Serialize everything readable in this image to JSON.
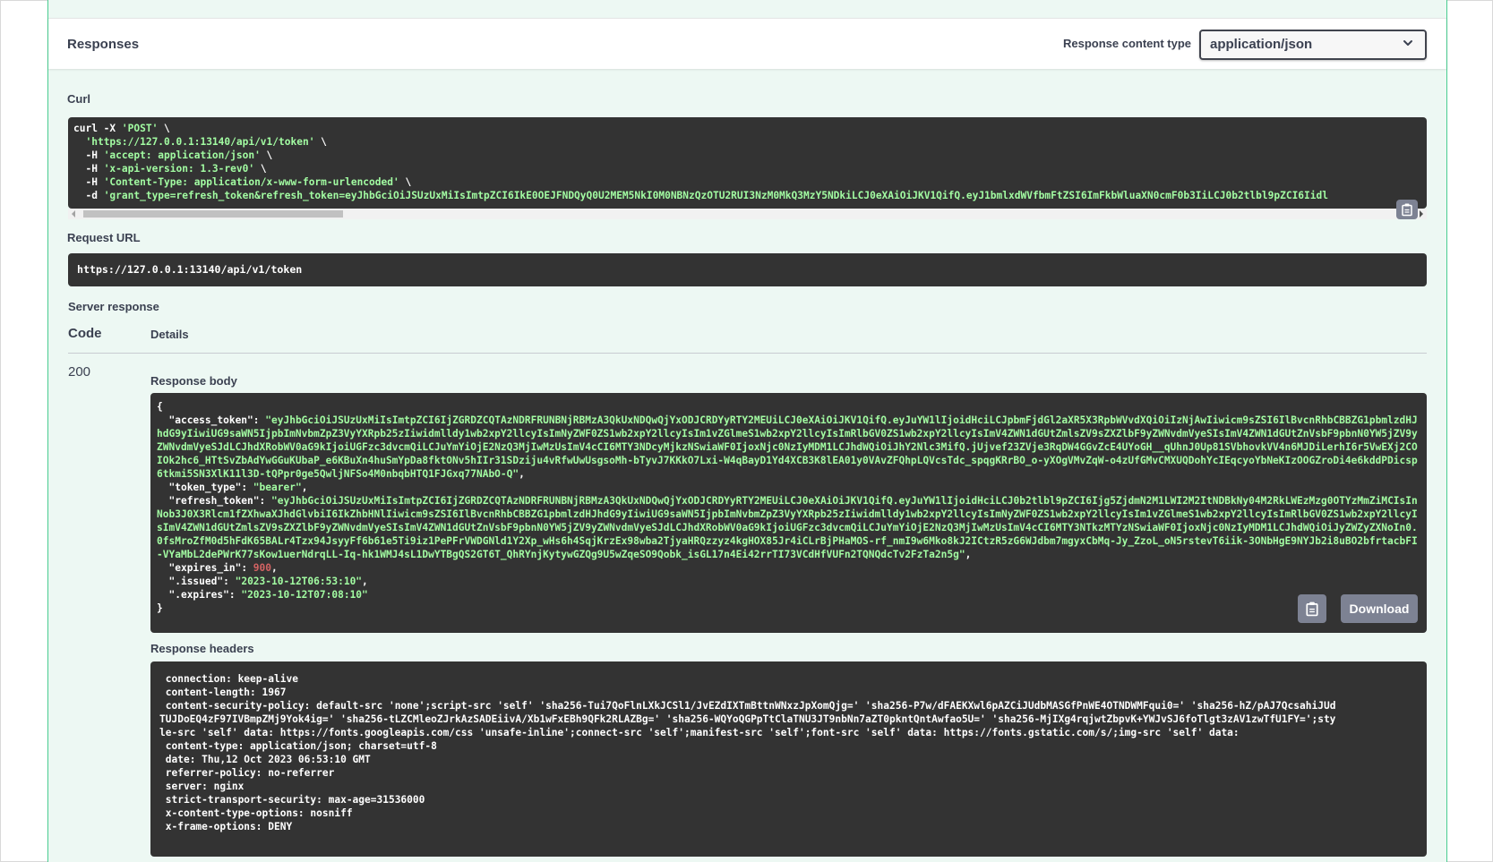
{
  "responses": {
    "title": "Responses",
    "content_type_label": "Response content type",
    "content_type_value": "application/json"
  },
  "curl": {
    "label": "Curl",
    "lines": [
      {
        "plain": "curl -X ",
        "str": "'POST'",
        "tail": " \\"
      },
      {
        "plain": "  ",
        "str": "'https://127.0.0.1:13140/api/v1/token'",
        "tail": " \\"
      },
      {
        "plain": "  -H ",
        "str": "'accept: application/json'",
        "tail": " \\"
      },
      {
        "plain": "  -H ",
        "str": "'x-api-version: 1.3-rev0'",
        "tail": " \\"
      },
      {
        "plain": "  -H ",
        "str": "'Content-Type: application/x-www-form-urlencoded'",
        "tail": " \\"
      },
      {
        "plain": "  -d ",
        "str": "'grant_type=refresh_token&refresh_token=eyJhbGciOiJSUzUxMiIsImtpZCI6IkE0OEJFNDQyQ0U2MEM5NkI0M0NBNzQzOTU2RUI3NzM0MkQ3MzY5NDkiLCJ0eXAiOiJKV1QifQ.eyJ1bmlxdWVfbmFtZSI6ImFkbWluaXN0cmF0b3IiLCJ0b2tlbl9pZCI6Iidl",
        "tail": ""
      }
    ]
  },
  "request_url": {
    "label": "Request URL",
    "value": "https://127.0.0.1:13140/api/v1/token"
  },
  "server_response": {
    "label": "Server response",
    "col_code": "Code",
    "col_details": "Details",
    "status_code": "200"
  },
  "response_body": {
    "label": "Response body",
    "open": "{",
    "access_token_key": "\"access_token\"",
    "access_token_value": "\"eyJhbGciOiJSUzUxMiIsImtpZCI6IjZGRDZCQTAzNDRFRUNBNjRBMzA3QkUxNDQwQjYxODJCRDYyRTY2MEUiLCJ0eXAiOiJKV1QifQ.eyJuYW1lIjoidHciLCJpbmFjdGl2aXR5X3RpbWVvdXQiOiIzNjAwIiwicm9sZSI6IlBvcnRhbCBBZG1pbmlzdHJhdG9yIiwiUG9saWN5IjpbImNvbmZpZ3VyYXRpb25zIiwidmlldy1wb2xpY2llcyIsImNyZWF0ZS1wb2xpY2llcyIsIm1vZGlmeS1wb2xpY2llcyIsImRlbGV0ZS1wb2xpY2llcyIsImV4ZWN1dGUtZmlsZV9sZXZlbF9yZWNvdmVyeSIsImV4ZWN1dGUtZnVsbF9pbnN0YW5jZV9yZWNvdmVyeSJdLCJhdXRobWV0aG9kIjoiUGFzc3dvcmQiLCJuYmYiOjE2NzQ3MjIwMzUsImV4cCI6MTY3NDcyMjkzNSwiaWF0IjoxNjc0NzIyMDM1LCJhdWQiOiJhY2Nlc3MifQ.jUjvef23ZVje3RqDW4GGvZcE4UYoGH__qUhnJ0Up81SVbhovkVV4n6MJDiLerhI6r5VwEXj2COIOk2hc6_HTtSvZbAdYwGGuKUbaP_e6KBuXn4huSmYpDa8fktONv5hIIr31SDziju4vRfwUwUsgsoMh-bTyvJ7KKkO7Lxi-W4qBayD1Yd4XCB3K8lEA01y0VAvZFQhpLQVcsTdc_spqgKRrBO_o-yXOgVMvZqW-o4zUfGMvCMXUQDohYcIEqcyoYbNeKIzOOGZroDi4e6kddPDicsp6tkmi5SN3XlK11l3D-tQPpr0ge5QwljNFSo4M0nbqbHTQ1FJGxq77NAbO-Q\"",
    "token_type_key": "\"token_type\"",
    "token_type_value": "\"bearer\"",
    "refresh_token_key": "\"refresh_token\"",
    "refresh_token_value": "\"eyJhbGciOiJSUzUxMiIsImtpZCI6IjZGRDZCQTAzNDRFRUNBNjRBMzA3QkUxNDQwQjYxODJCRDYyRTY2MEUiLCJ0eXAiOiJKV1QifQ.eyJuYW1lIjoidHciLCJ0b2tlbl9pZCI6Ijg5ZjdmN2M1LWI2M2ItNDBkNy04M2RkLWEzMzg0OTYzMmZiMCIsInNob3J0X3Rlcm1fZXhwaXJhdGlvbiI6IkZhbHNlIiwicm9sZSI6IlBvcnRhbCBBZG1pbmlzdHJhdG9yIiwiUG9saWN5IjpbImNvbmZpZ3VyYXRpb25zIiwidmlldy1wb2xpY2llcyIsImNyZWF0ZS1wb2xpY2llcyIsIm1vZGlmeS1wb2xpY2llcyIsImRlbGV0ZS1wb2xpY2llcyIsImV4ZWN1dGUtZmlsZV9sZXZlbF9yZWNvdmVyeSIsImV4ZWN1dGUtZnVsbF9pbnN0YW5jZV9yZWNvdmVyeSJdLCJhdXRobWV0aG9kIjoiUGFzc3dvcmQiLCJuYmYiOjE2NzQ3MjIwMzUsImV4cCI6MTY3NTkzMTYzNSwiaWF0IjoxNjc0NzIyMDM1LCJhdWQiOiJyZWZyZXNoIn0.0fsMroZfM0d5hFdK65BALr4Tzx94JsyyFf6b61e5Ti9iz1PePFrVWDGNld1Y2Xp_wHs6h4SqjKrzEx98wba2TjyaHRQzzyz4kgHOX85Jr4iCLrBjPHaMOS-rf_nmI9w6Mko8kJ2ICtzR5zG6WJdbm7mgyxCbMq-Jy_ZzoL_oN5rstevT6iik-3ONbHgE9NYJb2i8uBO2bfrtacbFI-VYaMbL2dePWrK77sKow1uerNdrqLL-Iq-hk1WMJ4sL1DwYTBgQS2GT6T_QhRYnjKytywGZQg9U5wZqeSO9Qobk_isGL17n4Ei42rrTI73VCdHfVUFn2TQNQdcTv2FzTa2n5g\"",
    "expires_in_key": "\"expires_in\"",
    "expires_in_value": "900",
    "issued_key": "\".issued\"",
    "issued_value": "\"2023-10-12T06:53:10\"",
    "expires_key": "\".expires\"",
    "expires_value": "\"2023-10-12T07:08:10\"",
    "close": "}",
    "download_label": "Download"
  },
  "response_headers": {
    "label": "Response headers",
    "text": " connection: keep-alive \n content-length: 1967 \n content-security-policy: default-src 'none';script-src 'self' 'sha256-Tui7QoFlnLXkJCSl1/JvEZdIXTmBttnWNxzJpXomQjg=' 'sha256-P7w/dFAEKXwl6pAZCiJUdbMASGfPnWE4OTNDWMFqui0=' 'sha256-hZ/pAJ7QcsahiJUdTUJDoEQ4zF97IVBmpZMj9Yok4ig=' 'sha256-tLZCMleoZJrkAzSADEiivA/Xb1wFxEBh9QFk2RLAZBg=' 'sha256-WQYoQGPpTtClaTNU3JT9nbNn7aZT0pkntQntAwfao5U=' 'sha256-MjIXg4rqjwtZbpvK+YWJvSJ6foTlgt3zAV1zwTfU1FY=';style-src 'self' data: https://fonts.googleapis.com/css 'unsafe-inline';connect-src 'self';manifest-src 'self';font-src 'self' data: https://fonts.gstatic.com/s/;img-src 'self' data: \n content-type: application/json; charset=utf-8 \n date: Thu,12 Oct 2023 06:53:10 GMT \n referrer-policy: no-referrer \n server: nginx \n strict-transport-security: max-age=31536000 \n x-content-type-options: nosniff \n x-frame-options: DENY "
  },
  "icons": [
    "chevron-down-icon",
    "clipboard-icon"
  ],
  "colors": {
    "accent": "#49cc90",
    "code_bg": "#333333",
    "string": "#a2fca2",
    "number": "#d36363",
    "button": "#7d8293"
  }
}
